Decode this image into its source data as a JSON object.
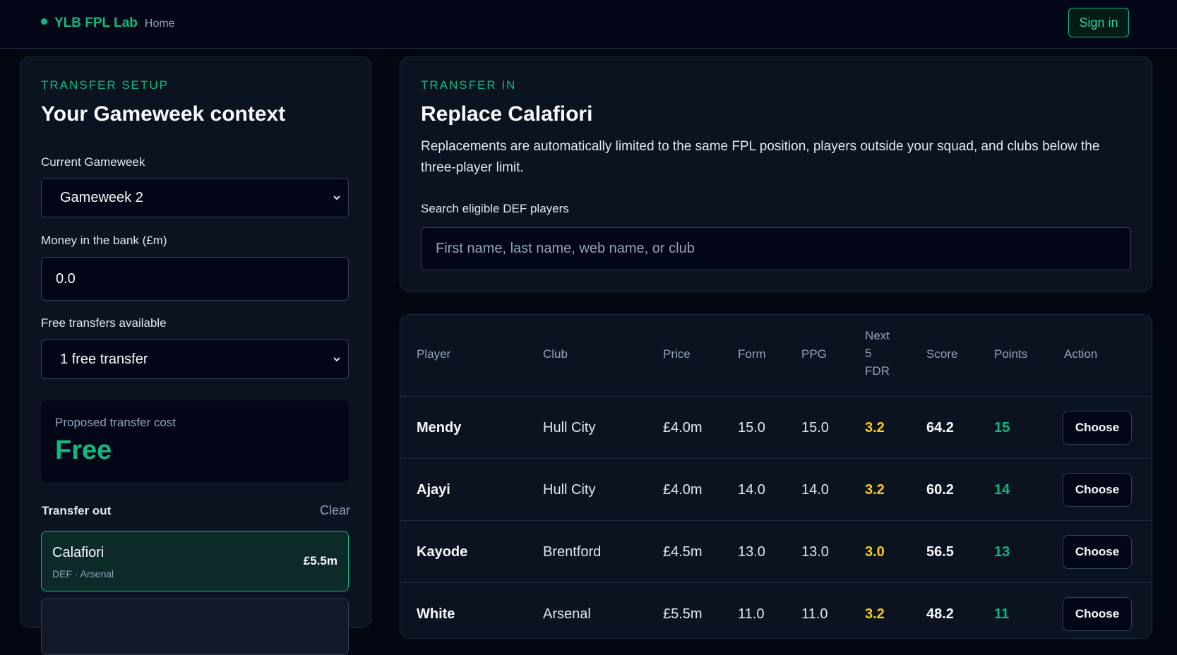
{
  "topbar": {
    "brand": "YLB FPL Lab",
    "home": "Home",
    "signin": "Sign in"
  },
  "setup": {
    "eyebrow": "TRANSFER SETUP",
    "title": "Your Gameweek context",
    "gameweek_label": "Current Gameweek",
    "gameweek_value": "Gameweek 2",
    "bank_label": "Money in the bank (£m)",
    "bank_value": "0.0",
    "ft_label": "Free transfers available",
    "ft_value": "1 free transfer",
    "cost_label": "Proposed transfer cost",
    "cost_value": "Free",
    "out_title": "Transfer out",
    "clear": "Clear",
    "out_player": {
      "name": "Calafiori",
      "meta": "DEF · Arsenal",
      "price": "£5.5m"
    }
  },
  "transfer_in": {
    "eyebrow": "TRANSFER IN",
    "title": "Replace Calafiori",
    "desc": "Replacements are automatically limited to the same FPL position, players outside your squad, and clubs below the three-player limit.",
    "search_label": "Search eligible DEF players",
    "search_placeholder": "First name, last name, web name, or club"
  },
  "table": {
    "headers": {
      "player": "Player",
      "club": "Club",
      "price": "Price",
      "form": "Form",
      "ppg": "PPG",
      "fdr_1": "Next",
      "fdr_2": "5",
      "fdr_3": "FDR",
      "score": "Score",
      "points": "Points",
      "action": "Action"
    },
    "rows": [
      {
        "player": "Mendy",
        "club": "Hull City",
        "price": "£4.0m",
        "form": "15.0",
        "ppg": "15.0",
        "fdr": "3.2",
        "score": "64.2",
        "points": "15",
        "action": "Choose"
      },
      {
        "player": "Ajayi",
        "club": "Hull City",
        "price": "£4.0m",
        "form": "14.0",
        "ppg": "14.0",
        "fdr": "3.2",
        "score": "60.2",
        "points": "14",
        "action": "Choose"
      },
      {
        "player": "Kayode",
        "club": "Brentford",
        "price": "£4.5m",
        "form": "13.0",
        "ppg": "13.0",
        "fdr": "3.0",
        "score": "56.5",
        "points": "13",
        "action": "Choose"
      },
      {
        "player": "White",
        "club": "Arsenal",
        "price": "£5.5m",
        "form": "11.0",
        "ppg": "11.0",
        "fdr": "3.2",
        "score": "48.2",
        "points": "11",
        "action": "Choose"
      }
    ]
  }
}
